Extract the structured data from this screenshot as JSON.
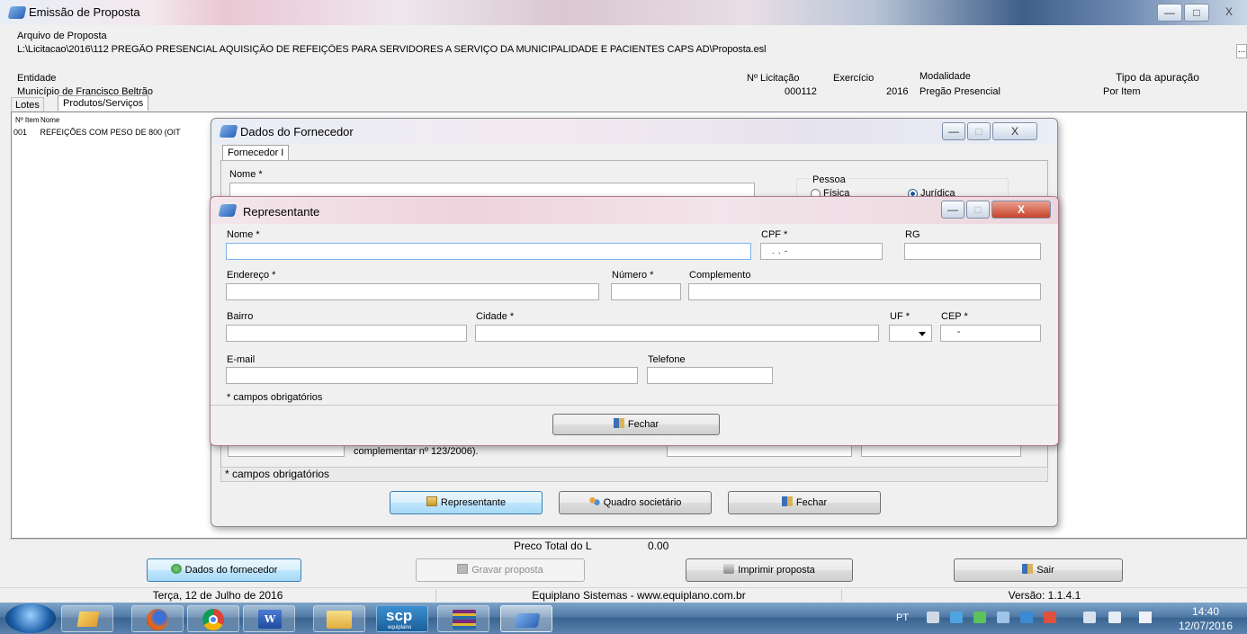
{
  "main_window": {
    "title": "Emissão de Proposta",
    "minimize": "—",
    "maximize": "□",
    "close": "X"
  },
  "arquivo": {
    "label": "Arquivo de Proposta",
    "path": "L:\\Licitacao\\2016\\112 PREGÃO PRESENCIAL AQUISIÇÃO DE REFEIÇÕES PARA SERVIDORES A SERVIÇO DA MUNICIPALIDADE E PACIENTES CAPS AD\\Proposta.esl",
    "browse": "..."
  },
  "header_info": {
    "entidade_label": "Entidade",
    "entidade_value": "Município de Francisco Beltrão",
    "licitacao_label": "Nº Licitação",
    "licitacao_value": "000112",
    "exercicio_label": "Exercício",
    "exercicio_value": "2016",
    "modalidade_label": "Modalidade",
    "modalidade_value": "Pregão Presencial",
    "apuracao_label": "Tipo da apuração",
    "apuracao_value": "Por Item"
  },
  "tabs": [
    "Lotes",
    "Produtos/Serviços"
  ],
  "items_table": {
    "headers": [
      "Nº Item",
      "Nome"
    ],
    "rows": [
      [
        "001",
        "REFEIÇÕES COM PESO DE 800 (OIT"
      ]
    ]
  },
  "total": {
    "label": "Preco Total do L",
    "value": "0.00"
  },
  "bottom_buttons": {
    "dados_fornecedor": "Dados do fornecedor",
    "gravar": "Gravar proposta",
    "imprimir": "Imprimir proposta",
    "sair": "Sair"
  },
  "status_bar": {
    "date": "Terça, 12 de Julho de 2016",
    "company": "Equiplano Sistemas - www.equiplano.com.br",
    "version": "Versão: 1.1.4.1"
  },
  "fornecedor_dialog": {
    "title": "Dados do Fornecedor",
    "tab": "Fornecedor I",
    "nome_label": "Nome *",
    "pessoa_label": "Pessoa",
    "fisica": "Física",
    "juridica": "Jurídica",
    "partial_text": "complementar nº 123/2006).",
    "required_note": "* campos obrigatórios",
    "btn_representante": "Representante",
    "btn_quadro": "Quadro societário",
    "btn_fechar": "Fechar"
  },
  "representante_dialog": {
    "title": "Representante",
    "nome_label": "Nome *",
    "cpf_label": "CPF *",
    "cpf_mask": ". . -",
    "rg_label": "RG",
    "endereco_label": "Endereço *",
    "numero_label": "Número *",
    "complemento_label": "Complemento",
    "bairro_label": "Bairro",
    "cidade_label": "Cidade *",
    "uf_label": "UF *",
    "cep_label": "CEP *",
    "cep_mask": "-",
    "email_label": "E-mail",
    "telefone_label": "Telefone",
    "required_note": "* campos obrigatórios",
    "btn_fechar": "Fechar"
  },
  "taskbar": {
    "scp_label": "scp",
    "scp_sub": "equiplano",
    "lang": "PT",
    "time": "14:40",
    "date": "12/07/2016"
  }
}
